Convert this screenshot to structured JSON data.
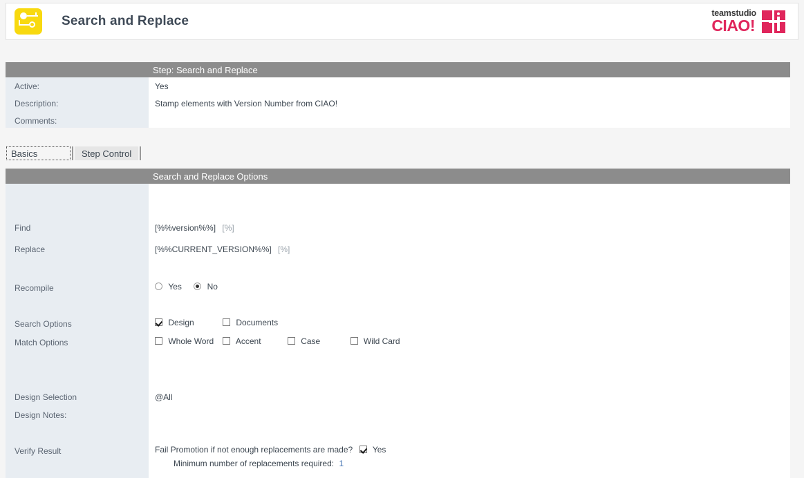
{
  "header": {
    "title": "Search and Replace",
    "app_icon": "search-replace-icon",
    "brand": {
      "top": "teamstudio",
      "main": "CIAO!",
      "mark": "ciao-logo-mark",
      "color": "#e0265c"
    },
    "logo_color": "#f8d90f"
  },
  "step": {
    "heading": "Step:  Search and Replace",
    "rows": [
      {
        "label": "Active:",
        "value": "Yes"
      },
      {
        "label": "Description:",
        "value": "Stamp elements with Version Number from CIAO!"
      },
      {
        "label": "Comments:",
        "value": ""
      }
    ]
  },
  "tabs": [
    {
      "label": "Basics",
      "active": true
    },
    {
      "label": "Step Control",
      "active": false
    }
  ],
  "options": {
    "heading": "Search and Replace Options",
    "find": {
      "label": "Find",
      "value": "[%%version%%]",
      "hint": "[%]"
    },
    "replace": {
      "label": "Replace",
      "value": "[%%CURRENT_VERSION%%]",
      "hint": "[%]"
    },
    "recompile": {
      "label": "Recompile",
      "yes_label": "Yes",
      "no_label": "No",
      "selected": "No"
    },
    "search_options": {
      "label": "Search Options",
      "items": [
        {
          "label": "Design",
          "checked": true
        },
        {
          "label": "Documents",
          "checked": false
        }
      ]
    },
    "match_options": {
      "label": "Match Options",
      "items": [
        {
          "label": "Whole Word",
          "checked": false
        },
        {
          "label": "Accent",
          "checked": false
        },
        {
          "label": "Case",
          "checked": false
        },
        {
          "label": "Wild Card",
          "checked": false
        }
      ]
    },
    "design_selection": {
      "label": "Design Selection",
      "value": "@All"
    },
    "design_notes": {
      "label": "Design Notes:",
      "value": ""
    },
    "verify_result": {
      "label": "Verify Result",
      "fail_promotion_question": "Fail Promotion if not enough replacements are made?",
      "fail_promotion_checked": true,
      "fail_promotion_yes_label": "Yes",
      "minimum_label": "Minimum number of replacements required:",
      "minimum_value": "1"
    }
  },
  "colors": {
    "header_bar": "#8c8c8c",
    "label_column": "#e8edf2",
    "page_background": "#f5f5f5",
    "accent_number": "#3f6fb0"
  }
}
